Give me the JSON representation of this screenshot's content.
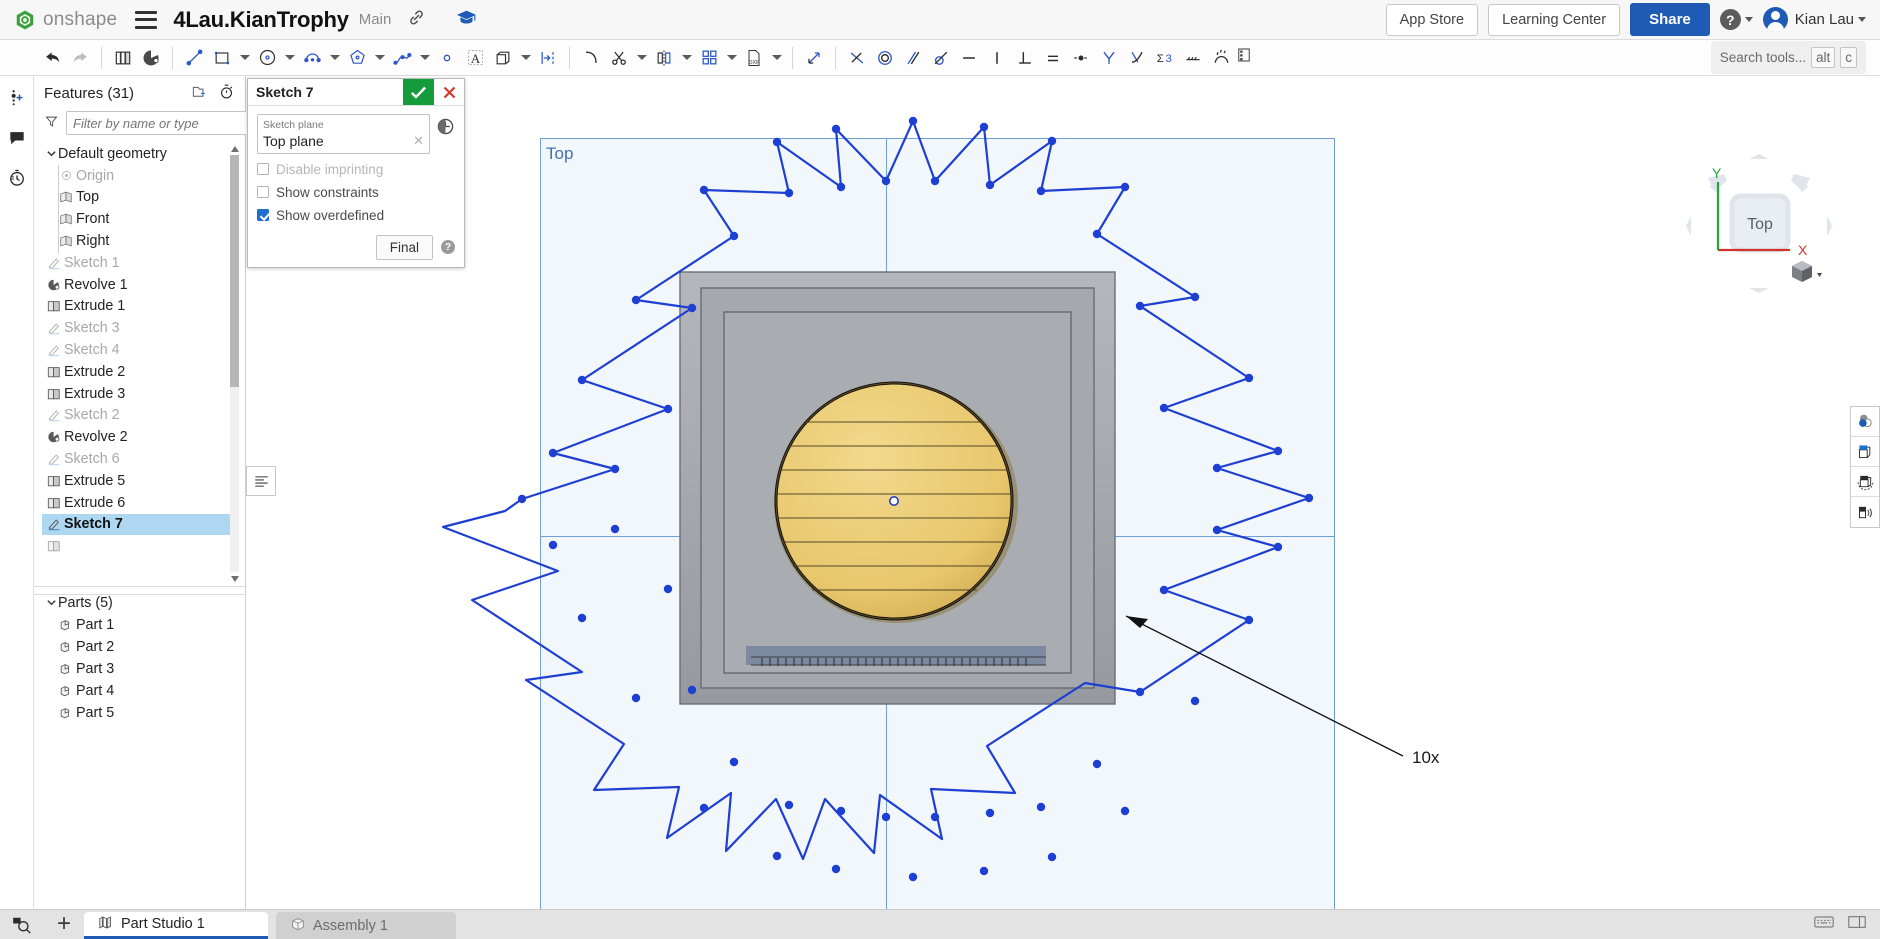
{
  "app": {
    "brand": "onshape",
    "document_title": "4Lau.KianTrophy",
    "branch": "Main",
    "link_icon": "link-icon",
    "learning_icon": "graduation-cap-icon"
  },
  "topbar": {
    "app_store": "App Store",
    "learning_center": "Learning Center",
    "share": "Share",
    "help": "?",
    "user_name": "Kian Lau",
    "accent_blue": "#1f5bb5"
  },
  "toolbar": {
    "search_placeholder": "Search tools...",
    "kbd_alt": "alt",
    "kbd_key": "c",
    "tools": [
      {
        "name": "undo-icon"
      },
      {
        "name": "redo-icon"
      },
      {
        "name": "copy-icon"
      },
      {
        "name": "sketch-entity-icon"
      },
      {
        "name": "line-icon"
      },
      {
        "name": "rectangle-icon"
      },
      {
        "name": "circle-icon"
      },
      {
        "name": "arc-icon"
      },
      {
        "name": "polygon-icon"
      },
      {
        "name": "spline-icon"
      },
      {
        "name": "point-icon"
      },
      {
        "name": "text-icon"
      },
      {
        "name": "use-projection-icon"
      },
      {
        "name": "offset-icon"
      },
      {
        "name": "fillet-icon"
      },
      {
        "name": "trim-icon"
      },
      {
        "name": "mirror-icon"
      },
      {
        "name": "linear-pattern-icon"
      },
      {
        "name": "dxf-import-icon"
      },
      {
        "name": "dimension-icon"
      },
      {
        "name": "coincident-icon"
      },
      {
        "name": "concentric-icon"
      },
      {
        "name": "parallel-icon"
      },
      {
        "name": "tangent-icon"
      },
      {
        "name": "horizontal-icon"
      },
      {
        "name": "vertical-icon"
      },
      {
        "name": "perpendicular-icon"
      },
      {
        "name": "equal-icon"
      },
      {
        "name": "midpoint-icon"
      },
      {
        "name": "symmetric-icon"
      },
      {
        "name": "curvature-icon"
      },
      {
        "name": "constraint-sum-icon"
      },
      {
        "name": "construction-icon"
      },
      {
        "name": "arc-constraint-icon"
      }
    ]
  },
  "rail": {
    "items": [
      {
        "name": "add-feature-icon"
      },
      {
        "name": "comment-icon"
      },
      {
        "name": "history-icon"
      }
    ]
  },
  "feature_panel": {
    "title": "Features (31)",
    "folder_icon": "new-folder-icon",
    "rollback_icon": "stopwatch-icon",
    "filter_icon": "filter-icon",
    "filter_placeholder": "Filter by name or type",
    "default_geometry": {
      "label": "Default geometry",
      "expanded": true,
      "items": [
        {
          "label": "Origin",
          "icon": "origin-icon",
          "dim": true
        },
        {
          "label": "Top",
          "icon": "plane-icon",
          "dim": false
        },
        {
          "label": "Front",
          "icon": "plane-icon",
          "dim": false
        },
        {
          "label": "Right",
          "icon": "plane-icon",
          "dim": false
        }
      ]
    },
    "features": [
      {
        "label": "Sketch 1",
        "icon": "sketch-icon",
        "dim": true,
        "selected": false
      },
      {
        "label": "Revolve 1",
        "icon": "revolve-icon",
        "dim": false,
        "selected": false
      },
      {
        "label": "Extrude 1",
        "icon": "extrude-icon",
        "dim": false,
        "selected": false
      },
      {
        "label": "Sketch 3",
        "icon": "sketch-icon",
        "dim": true,
        "selected": false
      },
      {
        "label": "Sketch 4",
        "icon": "sketch-icon",
        "dim": true,
        "selected": false
      },
      {
        "label": "Extrude 2",
        "icon": "extrude-icon",
        "dim": false,
        "selected": false
      },
      {
        "label": "Extrude 3",
        "icon": "extrude-icon",
        "dim": false,
        "selected": false
      },
      {
        "label": "Sketch 2",
        "icon": "sketch-icon",
        "dim": true,
        "selected": false
      },
      {
        "label": "Revolve 2",
        "icon": "revolve-icon",
        "dim": false,
        "selected": false
      },
      {
        "label": "Sketch 6",
        "icon": "sketch-icon",
        "dim": true,
        "selected": false
      },
      {
        "label": "Extrude 5",
        "icon": "extrude-icon",
        "dim": false,
        "selected": false
      },
      {
        "label": "Extrude 6",
        "icon": "extrude-icon",
        "dim": false,
        "selected": false
      },
      {
        "label": "Sketch 7",
        "icon": "sketch-icon",
        "dim": false,
        "selected": true
      }
    ],
    "parts": {
      "label": "Parts (5)",
      "expanded": true,
      "items": [
        {
          "label": "Part 1",
          "icon": "part-icon"
        },
        {
          "label": "Part 2",
          "icon": "part-icon"
        },
        {
          "label": "Part 3",
          "icon": "part-icon"
        },
        {
          "label": "Part 4",
          "icon": "part-icon"
        },
        {
          "label": "Part 5",
          "icon": "part-icon"
        }
      ]
    }
  },
  "sketch_dialog": {
    "title": "Sketch 7",
    "confirm_icon": "checkmark-icon",
    "cancel_icon": "close-icon",
    "history_icon": "clock-icon",
    "plane_label": "Sketch plane",
    "plane_value": "Top plane",
    "clear_icon": "clear-x-icon",
    "checkboxes": [
      {
        "label": "Disable imprinting",
        "checked": false,
        "disabled": true
      },
      {
        "label": "Show constraints",
        "checked": false,
        "disabled": false
      },
      {
        "label": "Show overdefined",
        "checked": true,
        "disabled": false
      }
    ],
    "final_button": "Final",
    "help_icon": "question-icon"
  },
  "canvas": {
    "plane_label": "Top",
    "plane_fill": "#f2f7fc",
    "plane_border": "#6f9fd8",
    "sketch_color": "#1e3fd4",
    "disc_color": "#eccb73",
    "body_color": "#a0a3a8",
    "annotation": "10x",
    "list_icon": "sketch-list-icon",
    "view_buttons": [
      {
        "name": "display-style-icon"
      },
      {
        "name": "section-view-icon"
      },
      {
        "name": "rotate-view-icon"
      },
      {
        "name": "explode-view-icon"
      }
    ],
    "view_cube": {
      "face": "Top",
      "axis_x": "X",
      "axis_y": "Y",
      "x_color": "#d0342c",
      "y_color": "#2aa33e",
      "cube_icon": "view-cube-icon"
    }
  },
  "bottom": {
    "measure_icon": "measure-icon",
    "add_tab_icon": "plus-icon",
    "tabs": [
      {
        "label": "Part Studio 1",
        "icon": "part-studio-icon",
        "active": true
      },
      {
        "label": "Assembly 1",
        "icon": "assembly-icon",
        "active": false
      }
    ],
    "right_icons": [
      {
        "name": "keyboard-icon"
      },
      {
        "name": "panel-toggle-icon"
      }
    ]
  }
}
